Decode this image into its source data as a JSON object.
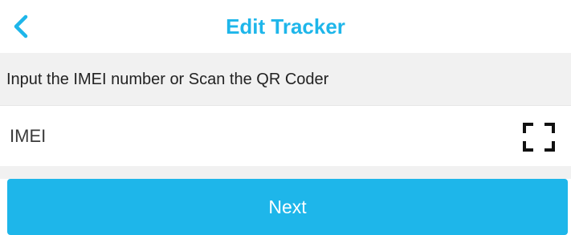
{
  "header": {
    "title": "Edit Tracker",
    "back_icon": "chevron-left-icon"
  },
  "instruction": {
    "text": "Input the IMEI number or Scan the QR Coder"
  },
  "imei": {
    "placeholder": "IMEI",
    "value": "",
    "scan_icon": "scan-frame-icon"
  },
  "actions": {
    "next_label": "Next"
  },
  "colors": {
    "accent": "#1eb6ea",
    "background_gray": "#f1f1f1",
    "text": "#222222"
  }
}
